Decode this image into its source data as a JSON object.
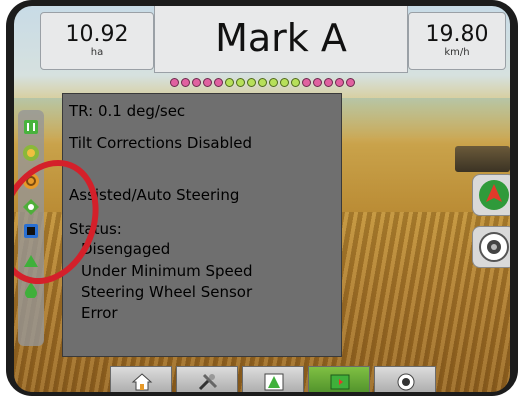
{
  "header": {
    "area_value": "10.92",
    "area_unit": "ha",
    "title": "Mark A",
    "speed_value": "19.80",
    "speed_unit": "km/h"
  },
  "lightbar": {
    "leds": [
      "pink",
      "pink",
      "pink",
      "pink",
      "pink",
      "green",
      "green",
      "green",
      "green",
      "green",
      "green",
      "green",
      "pink",
      "pink",
      "pink",
      "pink",
      "pink"
    ]
  },
  "side_strip": {
    "icons": [
      "section-icon",
      "guidance-icon",
      "steering-icon",
      "tilt-icon",
      "screen-icon",
      "arrow-up-icon",
      "drop-icon"
    ]
  },
  "info_panel": {
    "tilt_rate": "TR: 0.1 deg/sec",
    "tilt_corrections": "Tilt Corrections Disabled",
    "steering_mode": "Assisted/Auto Steering",
    "status_label": "Status:",
    "status_lines": [
      "Disengaged",
      "Under Minimum Speed",
      "Steering Wheel Sensor",
      "Error"
    ]
  },
  "right_buttons": [
    "navigation-arrow-icon",
    "camera-icon"
  ],
  "bottom_tabs": [
    "home-icon",
    "tools-icon",
    "field-icon",
    "map-icon",
    "camera-icon"
  ]
}
